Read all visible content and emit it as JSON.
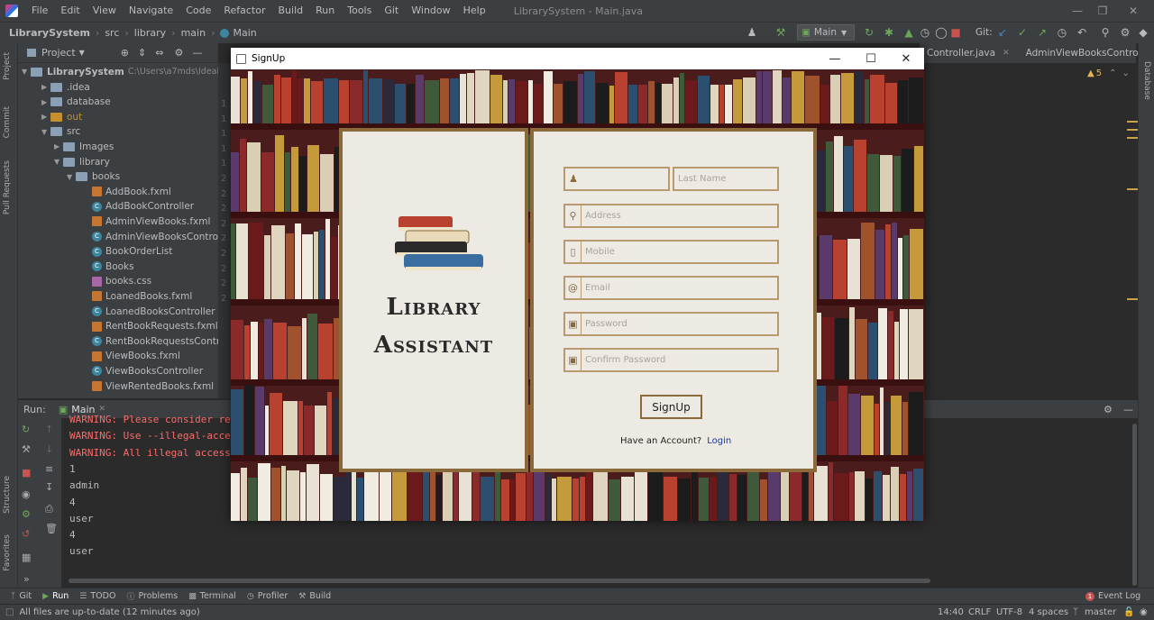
{
  "window": {
    "menus": [
      "File",
      "Edit",
      "View",
      "Navigate",
      "Code",
      "Refactor",
      "Build",
      "Run",
      "Tools",
      "Git",
      "Window",
      "Help"
    ],
    "title": "LibrarySystem - Main.java"
  },
  "nav": {
    "breadcrumbs": [
      "LibrarySystem",
      "src",
      "library",
      "main",
      "Main"
    ],
    "run_config": "Main",
    "git_label": "Git:"
  },
  "project": {
    "header": "Project",
    "root": "LibrarySystem",
    "root_path": "C:\\Users\\a7mds\\IdeaPro...",
    "items": [
      {
        "label": ".idea",
        "type": "folder"
      },
      {
        "label": "database",
        "type": "folder"
      },
      {
        "label": "out",
        "type": "folder-orange"
      },
      {
        "label": "src",
        "type": "folder"
      },
      {
        "label": "Images",
        "type": "folder"
      },
      {
        "label": "library",
        "type": "folder"
      },
      {
        "label": "books",
        "type": "folder"
      },
      {
        "label": "AddBook.fxml",
        "type": "fxml"
      },
      {
        "label": "AddBookController",
        "type": "class"
      },
      {
        "label": "AdminViewBooks.fxml",
        "type": "fxml"
      },
      {
        "label": "AdminViewBooksController",
        "type": "class"
      },
      {
        "label": "BookOrderList",
        "type": "class"
      },
      {
        "label": "Books",
        "type": "class"
      },
      {
        "label": "books.css",
        "type": "css"
      },
      {
        "label": "LoanedBooks.fxml",
        "type": "fxml"
      },
      {
        "label": "LoanedBooksController",
        "type": "class"
      },
      {
        "label": "RentBookRequests.fxml",
        "type": "fxml"
      },
      {
        "label": "RentBookRequestsController",
        "type": "class"
      },
      {
        "label": "ViewBooks.fxml",
        "type": "fxml"
      },
      {
        "label": "ViewBooksController",
        "type": "class"
      },
      {
        "label": "ViewRentedBooks.fxml",
        "type": "fxml"
      }
    ]
  },
  "editor": {
    "tabs": [
      "Controller.java",
      "AdminViewBooksContro"
    ],
    "warnings": "5",
    "line_numbers": [
      "1",
      "1",
      "1",
      "1",
      "1",
      "2",
      "2",
      "2",
      "2",
      "2",
      "2",
      "2",
      "2",
      "2"
    ]
  },
  "run": {
    "label": "Run:",
    "tab": "Main",
    "console": [
      {
        "text": "WARNING: Please consider re",
        "kind": "warn"
      },
      {
        "text": "WARNING: Use --illegal-acce",
        "kind": "warn"
      },
      {
        "text": "WARNING: All illegal access",
        "kind": "warn"
      },
      {
        "text": "1",
        "kind": "out"
      },
      {
        "text": "admin",
        "kind": "out"
      },
      {
        "text": "4",
        "kind": "out"
      },
      {
        "text": "user",
        "kind": "out"
      },
      {
        "text": "4",
        "kind": "out"
      },
      {
        "text": "user",
        "kind": "out"
      }
    ]
  },
  "bottom_tabs": [
    "Git",
    "Run",
    "TODO",
    "Problems",
    "Terminal",
    "Profiler",
    "Build"
  ],
  "event_log": {
    "label": "Event Log",
    "count": "1"
  },
  "status": {
    "message": "All files are up-to-date (12 minutes ago)",
    "position": "14:40",
    "line_sep": "CRLF",
    "encoding": "UTF-8",
    "indent": "4 spaces",
    "branch": "master"
  },
  "dialog": {
    "title": "SignUp",
    "brand_line1": "Library",
    "brand_line2": "Assistant",
    "fields": {
      "first_name": "",
      "last_name": "Last Name",
      "address": "Address",
      "mobile": "Mobile",
      "email": "Email",
      "password": "Password",
      "confirm_password": "Confirm Password"
    },
    "signup_button": "SignUp",
    "account_prompt": "Have an Account?",
    "login_link": "Login"
  },
  "colors": {
    "accent": "#8a6a3a",
    "card_bg": "#ede9e3",
    "link": "#1a3a9a"
  }
}
